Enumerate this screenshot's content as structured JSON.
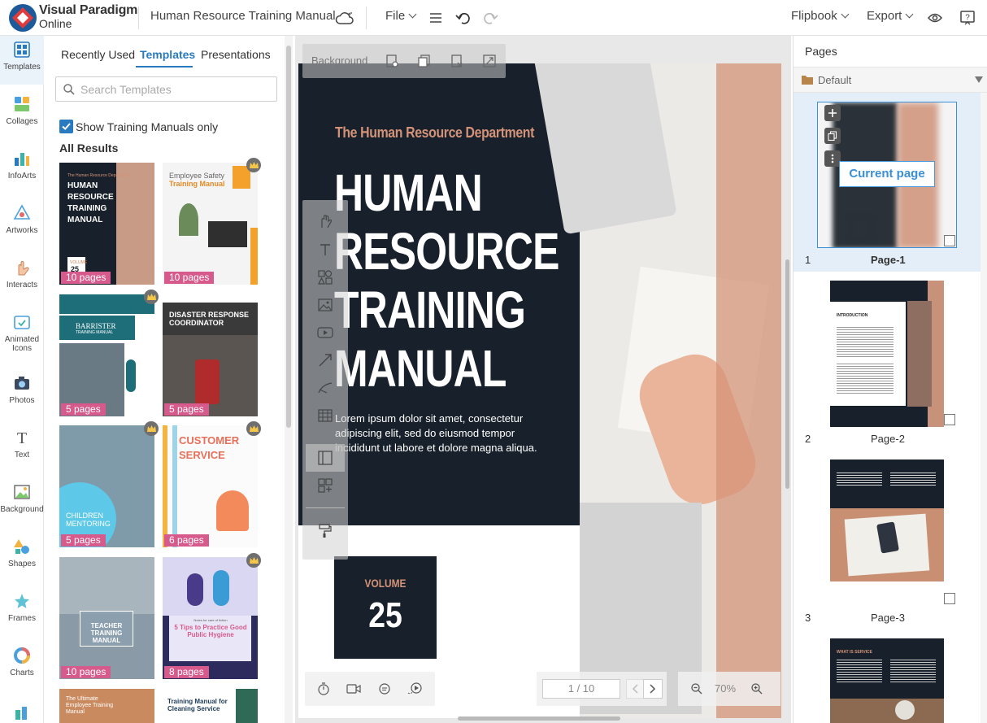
{
  "app": {
    "logo_line1": "Visual Paradigm",
    "logo_line2": "Online",
    "doc_title": "Human Resource Training Manual",
    "file_menu": "File",
    "flipbook_menu": "Flipbook",
    "export_menu": "Export"
  },
  "rail": {
    "items": [
      {
        "label": "Templates"
      },
      {
        "label": "Collages"
      },
      {
        "label": "InfoArts"
      },
      {
        "label": "Artworks"
      },
      {
        "label": "Interacts"
      },
      {
        "label": "Animated Icons"
      },
      {
        "label": "Photos"
      },
      {
        "label": "Text"
      },
      {
        "label": "Background"
      },
      {
        "label": "Shapes"
      },
      {
        "label": "Frames"
      },
      {
        "label": "Charts"
      }
    ]
  },
  "panel": {
    "tabs": [
      "Recently Used",
      "Templates",
      "Presentations"
    ],
    "search_placeholder": "Search Templates",
    "checkbox_label": "Show Training Manuals only",
    "results_title": "All Results",
    "templates": [
      {
        "title_top": "The Human Resource Department",
        "title": "HUMAN RESOURCE TRAINING MANUAL",
        "volume": "VOLUME",
        "volume_num": "25",
        "pages": "10 pages"
      },
      {
        "title": "Employee Safety",
        "subtitle": "Training Manual",
        "pages": "10 pages"
      },
      {
        "title": "BARRISTER",
        "subtitle": "TRAINING MANUAL",
        "pages": "5 pages"
      },
      {
        "title": "DISASTER RESPONSE COORDINATOR",
        "pages": "5 pages"
      },
      {
        "title": "CHILDREN MENTORING",
        "pages": "5 pages"
      },
      {
        "title": "CUSTOMER SERVICE",
        "pages": "6 pages"
      },
      {
        "title": "TEACHER TRAINING MANUAL",
        "pages": "10 pages"
      },
      {
        "title_top": "Notes for care of fiction",
        "title": "5 Tips to Practice Good Public Hygiene",
        "pages": "8 pages"
      },
      {
        "title": "The Ultimate Employee Training Manual"
      },
      {
        "title": "Training Manual for Cleaning Service"
      }
    ]
  },
  "canvas": {
    "background_label": "Background",
    "dept": "The Human Resource Department",
    "title_lines": [
      "HUMAN",
      "RESOURCE",
      "TRAINING",
      "MANUAL"
    ],
    "body": "Lorem ipsum dolor sit amet, consectetur adipiscing elit, sed do eiusmod tempor incididunt ut labore et dolore magna aliqua.",
    "volume_label": "VOLUME",
    "volume_num": "25",
    "page_indicator": "1 / 10",
    "zoom": "70%"
  },
  "pages_panel": {
    "title": "Pages",
    "section": "Default",
    "current_label": "Current page",
    "pages": [
      {
        "num": "1",
        "name": "Page-1"
      },
      {
        "num": "2",
        "name": "Page-2"
      },
      {
        "num": "3",
        "name": "Page-3"
      }
    ],
    "page2_heading": "INTRODUCTION",
    "page4_heading": "WHAT IS SERVICE"
  },
  "colors": {
    "accent": "#2a7abf",
    "navy": "#18212b",
    "salmon": "#d49378",
    "badge": "#d75a8c"
  }
}
